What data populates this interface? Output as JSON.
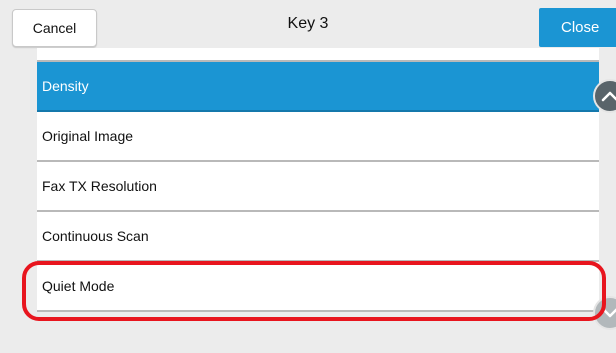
{
  "header": {
    "title": "Key 3",
    "cancel_label": "Cancel",
    "close_label": "Close"
  },
  "list": {
    "items": [
      {
        "label": "Density",
        "selected": true
      },
      {
        "label": "Original Image",
        "selected": false
      },
      {
        "label": "Fax TX Resolution",
        "selected": false
      },
      {
        "label": "Continuous Scan",
        "selected": false
      },
      {
        "label": "Quiet Mode",
        "selected": false,
        "highlighted": true
      }
    ]
  },
  "scroll": {
    "up_icon": "chevron-up-icon",
    "down_icon": "chevron-down-icon"
  },
  "colors": {
    "accent": "#1b95d3",
    "highlight_ring": "#e8151e",
    "background": "#ececec"
  }
}
